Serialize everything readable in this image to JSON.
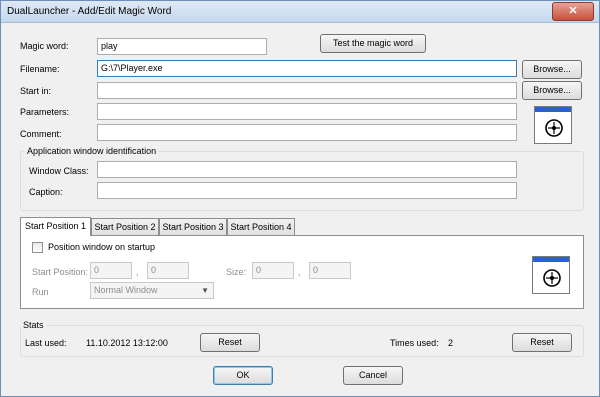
{
  "window": {
    "title": "DualLauncher - Add/Edit Magic Word",
    "close_glyph": "✕"
  },
  "form": {
    "magic_word_label": "Magic word:",
    "magic_word_value": "play",
    "test_button": "Test the magic word",
    "filename_label": "Filename:",
    "filename_value": "G:\\7\\Player.exe",
    "browse_button": "Browse...",
    "start_in_label": "Start in:",
    "start_in_value": "",
    "parameters_label": "Parameters:",
    "parameters_value": "",
    "comment_label": "Comment:",
    "comment_value": ""
  },
  "identification": {
    "legend": "Application window identification",
    "window_class_label": "Window Class:",
    "window_class_value": "",
    "caption_label": "Caption:",
    "caption_value": ""
  },
  "tabs": [
    {
      "label": "Start Position 1"
    },
    {
      "label": "Start Position 2"
    },
    {
      "label": "Start Position 3"
    },
    {
      "label": "Start Position 4"
    }
  ],
  "position": {
    "checkbox_label": "Position window on startup",
    "checked": false,
    "start_position_label": "Start Position:",
    "start_x": "0",
    "start_y": "0",
    "comma": ",",
    "size_label": "Size:",
    "size_w": "0",
    "size_h": "0",
    "run_label": "Run",
    "run_value": "Normal Window"
  },
  "stats": {
    "legend": "Stats",
    "last_used_label": "Last used:",
    "last_used_value": "11.10.2012 13:12:00",
    "reset_label": "Reset",
    "times_used_label": "Times used:",
    "times_used_value": "2"
  },
  "footer": {
    "ok_label": "OK",
    "cancel_label": "Cancel"
  },
  "icons": {
    "finder": "crosshair-target-icon"
  }
}
